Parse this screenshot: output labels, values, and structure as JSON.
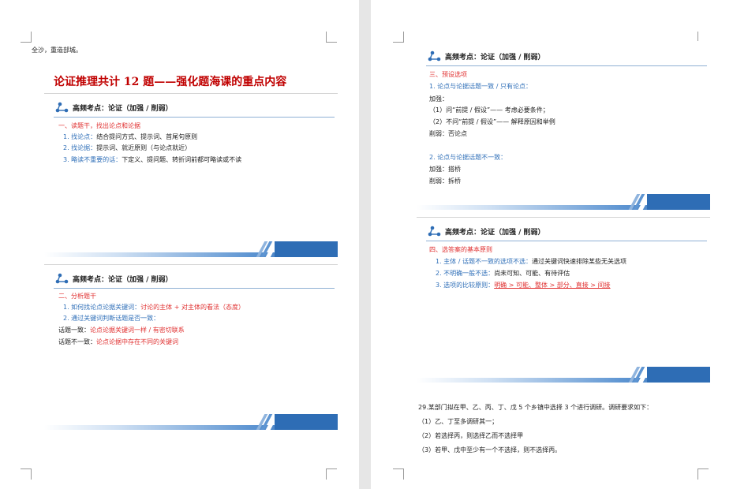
{
  "left_page": {
    "intro": "全沙，重造部城。",
    "title": "论证推理共计 12 题——强化题海课的重点内容",
    "slide1": {
      "header": "高频考点：论证（加强 / 削弱）",
      "section": "一、读题干，找出论点和论据",
      "lines": [
        {
          "label": "1. 找论点：",
          "text": "结合提问方式、提示词、首尾句原则"
        },
        {
          "label": "2. 找论据：",
          "text": "提示词、就近原则（与论点就近）"
        },
        {
          "label": "3. 略读不重要的话：",
          "text": "下定义、提问题、转折词前都可略读或不读"
        }
      ]
    },
    "slide2": {
      "header": "高频考点：论证（加强 / 削弱）",
      "section": "二、分析题干",
      "line1_label": "1. 如何找论点论据关键词：",
      "line1_text": "讨论的主体 + 对主体的看法（态度）",
      "line2_label": "2. 通过关键词判断话题是否一致：",
      "line3_label": "话题一致：",
      "line3_text": "论点论据关键词一样 / 有密切联系",
      "line4_label": "话题不一致：",
      "line4_text": "论点论据中存在不同的关键词"
    }
  },
  "right_page": {
    "slide3": {
      "header": "高频考点：论证（加强 / 削弱）",
      "section": "三、预设选项",
      "sub1": "1. 论点与论据话题一致 / 只有论点：",
      "lines1": [
        "加强：",
        "（1）问“前提 / 假设”—— 考虑必要条件；",
        "（2）不问“前提 / 假设”—— 解释原因和举例",
        "削弱：否论点"
      ],
      "sub2": "2. 论点与论据话题不一致：",
      "lines2": [
        "加强：搭桥",
        "削弱：拆桥"
      ]
    },
    "slide4": {
      "header": "高频考点：论证（加强 / 削弱）",
      "section": "四、选答案的基本原则",
      "line1_label": "1. 主体 / 话题不一致的选项不选：",
      "line1_text": "通过关键词快速排除某些无关选项",
      "line2_label": "2. 不明确一般不选：",
      "line2_text": "尚未可知、可能、有待评估",
      "line3_label": "3. 选项的比较原则：",
      "line3_text": "明确 > 可能、整体 > 部分、直接 > 间接"
    },
    "question": {
      "stem": "29.某部门拟在甲、乙、丙、丁、戊 5 个乡镇中选择 3 个进行调研。调研要求如下：",
      "conditions": [
        "（1）乙、丁至多调研其一；",
        "（2）若选择丙，则选择乙而不选择甲",
        "（3）若甲、戊中至少有一个不选择，则不选择丙。"
      ]
    }
  },
  "colors": {
    "title_red": "#c00000",
    "accent_red": "#e03030",
    "accent_blue": "#2f6fb8",
    "band_blue": "#2e6db5"
  }
}
